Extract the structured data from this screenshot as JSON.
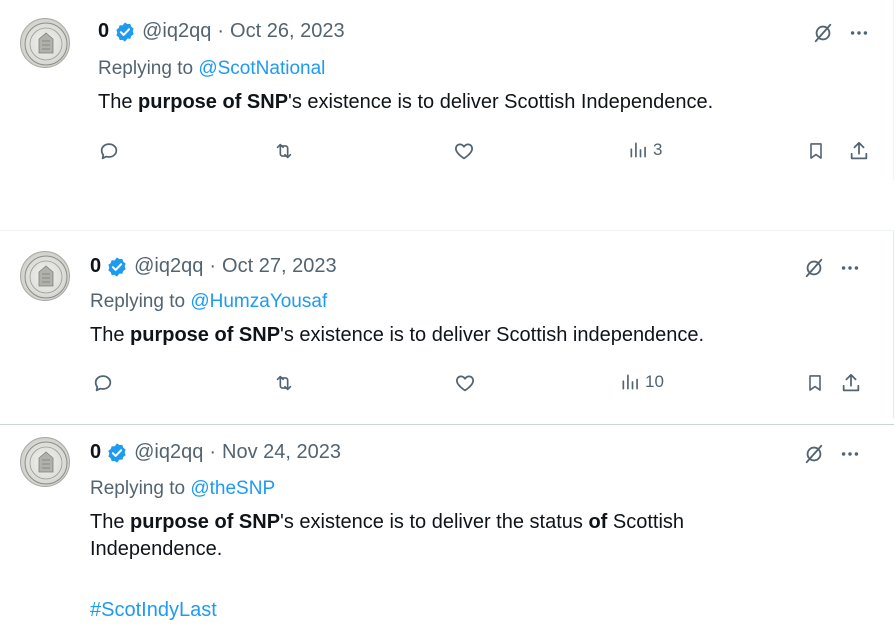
{
  "tweets": [
    {
      "author_name": "0",
      "handle": "@iq2qq",
      "separator": "·",
      "date": "Oct 26, 2023",
      "replying_prefix": "Replying to ",
      "replying_to": "@ScotNational",
      "text": {
        "t1": "The ",
        "b1": "purpose of SNP",
        "t2": "'s existence is to deliver Scottish Independence."
      },
      "views": "3"
    },
    {
      "author_name": "0",
      "handle": "@iq2qq",
      "separator": "·",
      "date": "Oct 27, 2023",
      "replying_prefix": "Replying to ",
      "replying_to": "@HumzaYousaf",
      "text": {
        "t1": "The ",
        "b1": "purpose of SNP",
        "t2": "'s existence is to deliver Scottish independence."
      },
      "views": "10"
    },
    {
      "author_name": "0",
      "handle": "@iq2qq",
      "separator": "·",
      "date": "Nov 24, 2023",
      "replying_prefix": "Replying to ",
      "replying_to": "@theSNP",
      "text": {
        "t1": "The ",
        "b1": "purpose of SNP",
        "t2": "'s existence is to deliver the status ",
        "b2": "of",
        "t3": " Scottish",
        "line2": "Independence."
      },
      "hashtag": "#ScotIndyLast"
    }
  ],
  "icons": {
    "verified": "verified-badge-icon",
    "grok": "grok-icon",
    "more": "more-icon",
    "reply": "reply-icon",
    "retweet": "retweet-icon",
    "like": "like-icon",
    "views": "views-icon",
    "bookmark": "bookmark-icon",
    "share": "share-icon",
    "avatar": "seal-avatar"
  },
  "colors": {
    "link": "#1d9bf0",
    "verified": "#1d9bf0",
    "secondary_text": "#536471",
    "primary_text": "#0f1419"
  }
}
